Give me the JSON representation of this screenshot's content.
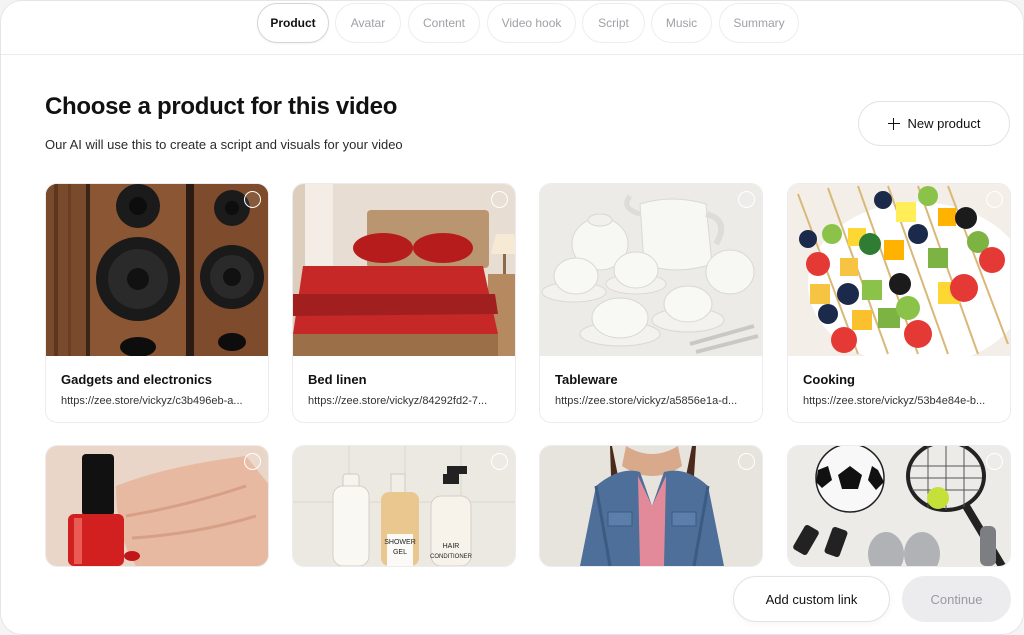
{
  "stepper": {
    "steps": [
      {
        "label": "Product",
        "active": true
      },
      {
        "label": "Avatar"
      },
      {
        "label": "Content"
      },
      {
        "label": "Video hook"
      },
      {
        "label": "Script"
      },
      {
        "label": "Music"
      },
      {
        "label": "Summary"
      }
    ]
  },
  "page": {
    "title": "Choose a product for this video",
    "subtitle": "Our AI will use this to create a script and visuals for your video"
  },
  "actions": {
    "new_product_label": "New product",
    "add_custom_link_label": "Add custom link",
    "continue_label": "Continue"
  },
  "products": [
    {
      "name": "Gadgets and electronics",
      "link": "https://zee.store/vickyz/c3b496eb-a...",
      "image": "speakers"
    },
    {
      "name": "Bed linen",
      "link": "https://zee.store/vickyz/84292fd2-7...",
      "image": "bed"
    },
    {
      "name": "Tableware",
      "link": "https://zee.store/vickyz/a5856e1a-d...",
      "image": "teaset"
    },
    {
      "name": "Cooking",
      "link": "https://zee.store/vickyz/53b4e84e-b...",
      "image": "fruit-skewers"
    },
    {
      "name": "",
      "link": "",
      "image": "nail-polish"
    },
    {
      "name": "",
      "link": "",
      "image": "shampoo-bottles",
      "image_text": [
        "SHOWER",
        "GEL",
        "HAIR",
        "CONDITIONER"
      ]
    },
    {
      "name": "",
      "link": "",
      "image": "denim-jacket"
    },
    {
      "name": "",
      "link": "",
      "image": "sports-equipment"
    }
  ]
}
